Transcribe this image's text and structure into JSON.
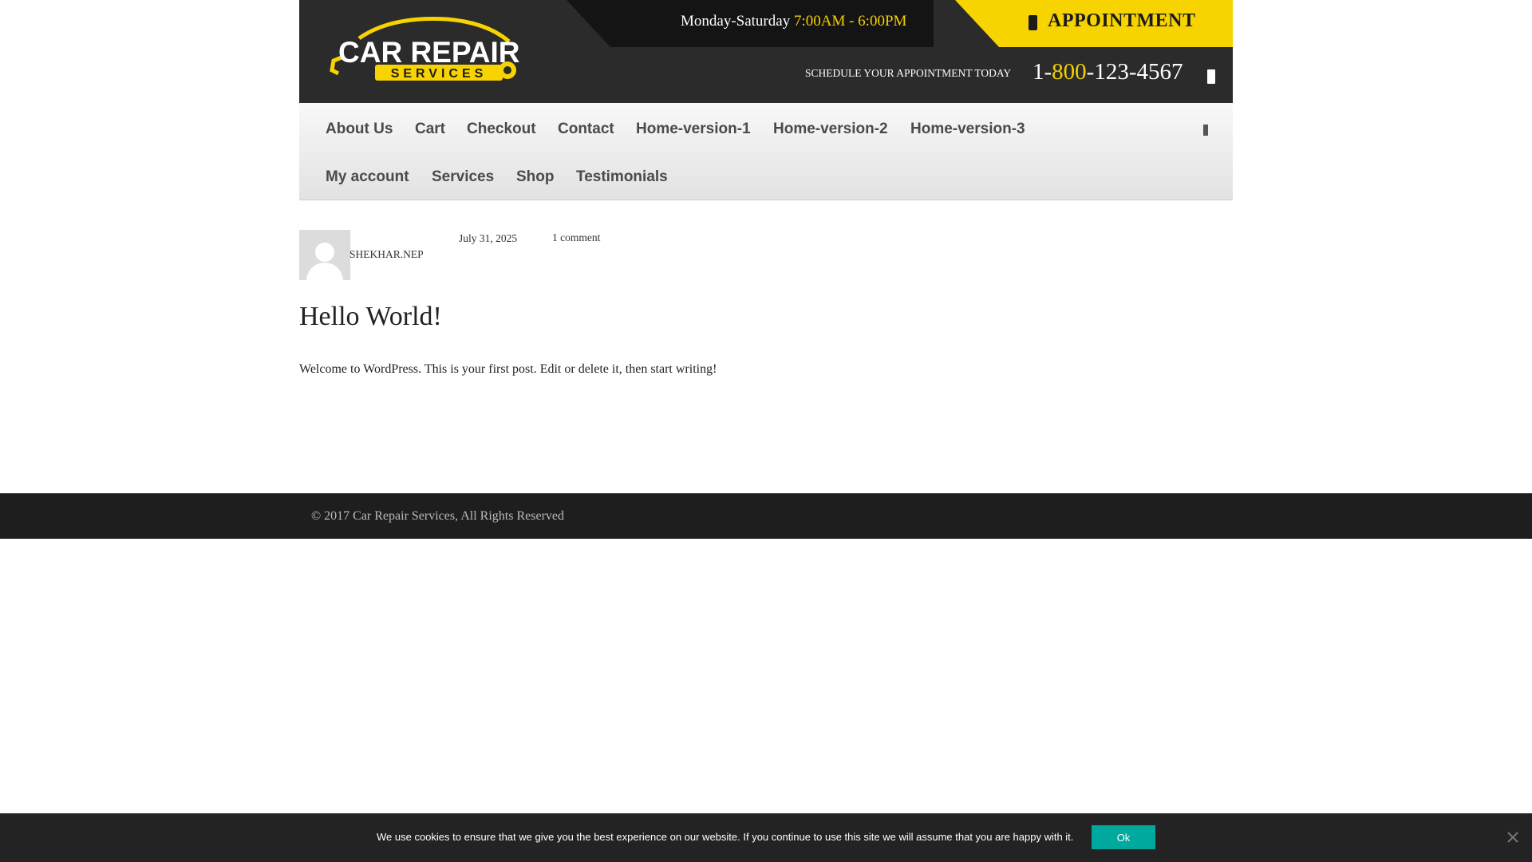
{
  "header": {
    "hours_days": "Monday-Saturday",
    "hours_times": "7:00AM - 6:00PM",
    "appointment_label": "APPOINTMENT",
    "schedule_text": "SCHEDULE YOUR APPOINTMENT TODAY",
    "phone_prefix": "1-",
    "phone_highlight": "800",
    "phone_rest": "-123-4567",
    "logo_main": "CAR REPAIR",
    "logo_sub": "SERVICES",
    "accent_color": "#f7d300"
  },
  "nav": {
    "items": [
      {
        "label": "About Us"
      },
      {
        "label": "Cart"
      },
      {
        "label": "Checkout"
      },
      {
        "label": "Contact"
      },
      {
        "label": "Home-version-1"
      },
      {
        "label": "Home-version-2"
      },
      {
        "label": "Home-version-3"
      },
      {
        "label": "My account"
      },
      {
        "label": "Services"
      },
      {
        "label": "Shop"
      },
      {
        "label": "Testimonials"
      }
    ],
    "search_icon": "search-icon"
  },
  "post": {
    "author": "SHEKHAR.NEP",
    "date": "July 31, 2025",
    "comments": "1 comment",
    "title": "Hello World!",
    "body": "Welcome to WordPress. This is your first post. Edit or delete it, then start writing!"
  },
  "footer": {
    "copyright": "© 2017 Car Repair Services, All Rights Reserved"
  },
  "cookie": {
    "text": "We use cookies to ensure that we give you the best experience on our website. If you continue to use this site we will assume that you are happy with it.",
    "ok_label": "Ok",
    "ok_color": "#00a99d"
  }
}
